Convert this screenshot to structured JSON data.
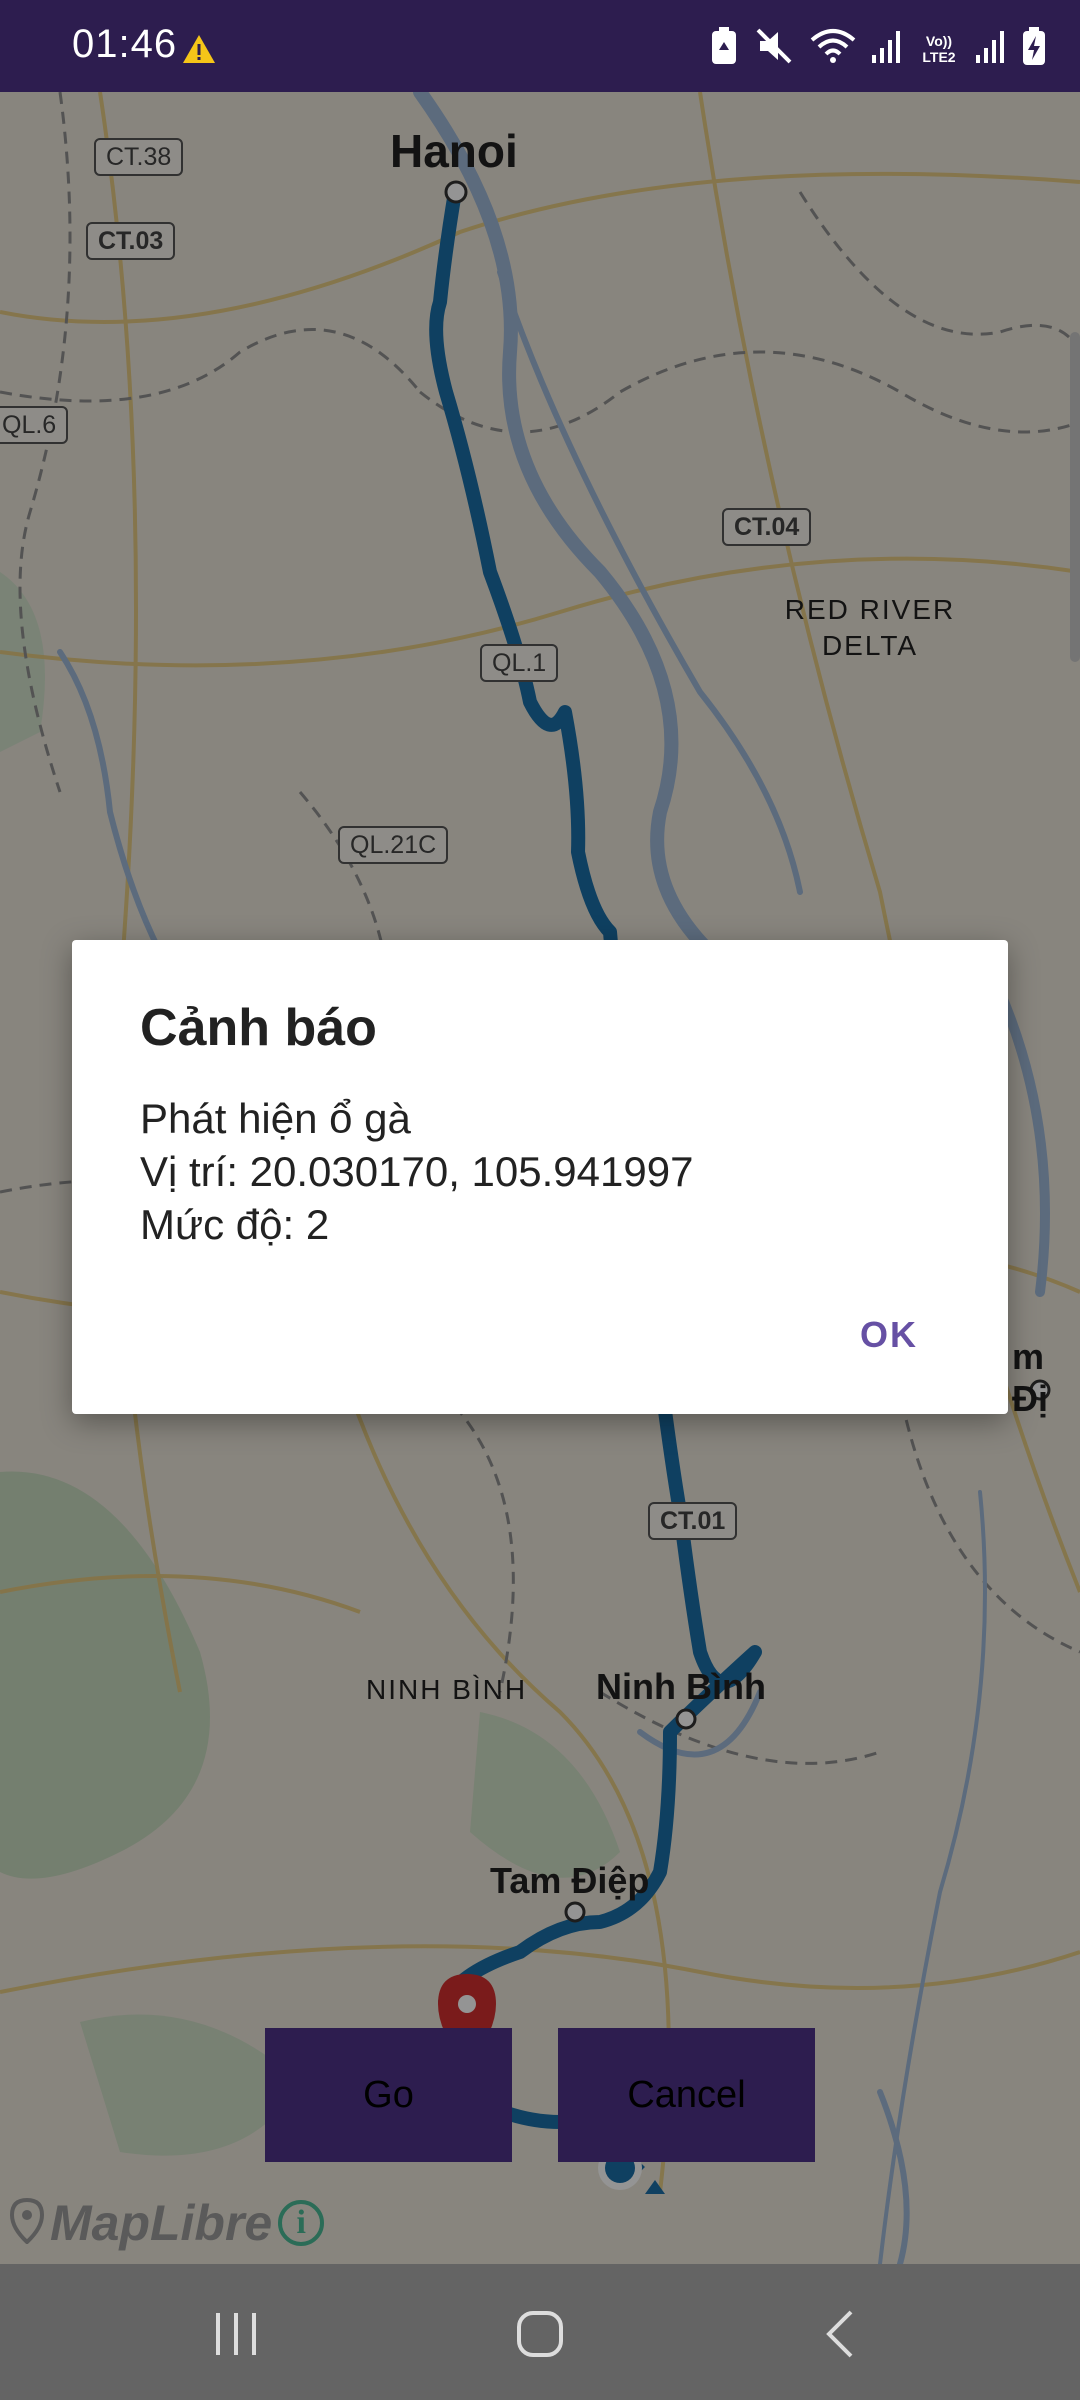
{
  "status_bar": {
    "time": "01:46",
    "network_label": "Vo)) LTE2"
  },
  "map": {
    "cities": [
      "Hanoi",
      "Ninh Bình",
      "Tam Điệp",
      "m Đị"
    ],
    "regions": [
      "RED RIVER DELTA",
      "NINH BÌNH"
    ],
    "road_shields": [
      "CT.38",
      "CT.03",
      "QL.6",
      "CT.04",
      "QL.1",
      "QL.21C",
      "CT.01"
    ],
    "attribution": "MapLibre",
    "colors": {
      "route": "#1b6fa8",
      "marker": "#d32f2f"
    }
  },
  "buttons": {
    "go": "Go",
    "cancel": "Cancel"
  },
  "dialog": {
    "title": "Cảnh báo",
    "line1": "Phát hiện ổ gà",
    "line2": "Vị trí: 20.030170, 105.941997",
    "line3": "Mức độ: 2",
    "ok": "OK"
  },
  "colors": {
    "accent": "#6650a4",
    "status_bar": "#2d1d4f"
  }
}
